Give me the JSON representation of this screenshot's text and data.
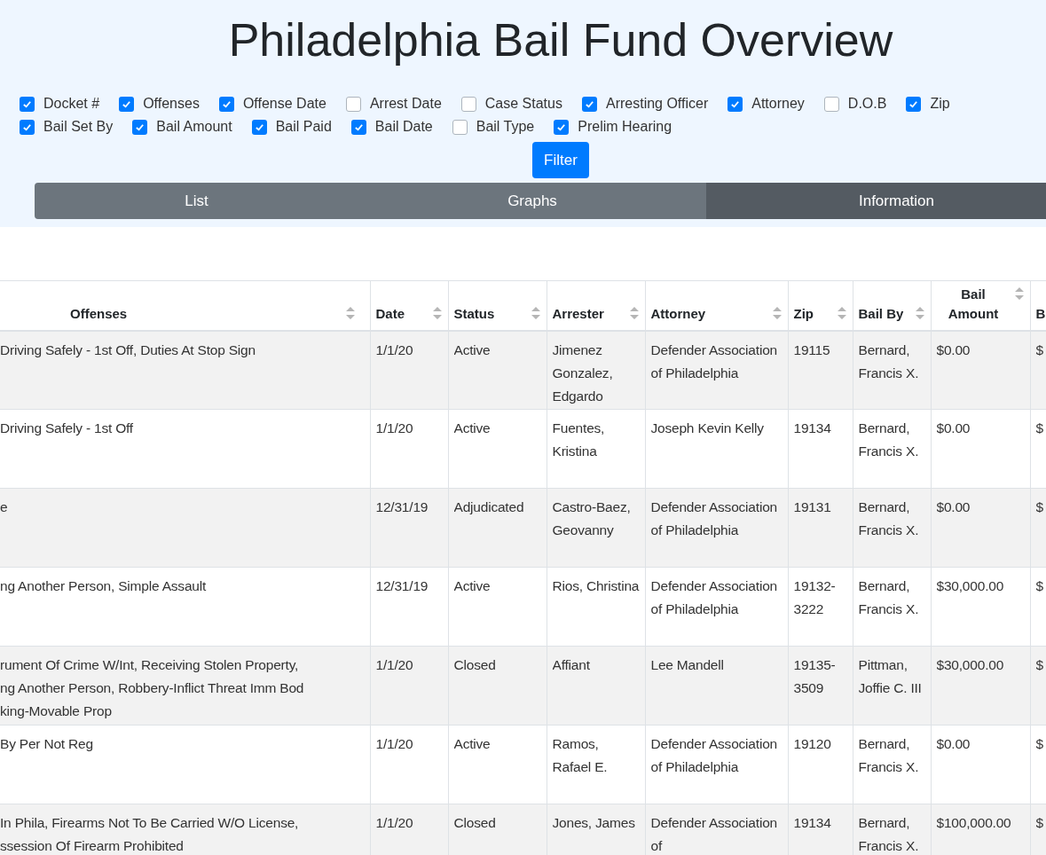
{
  "title": "Philadelphia Bail Fund Overview",
  "filters": [
    {
      "label": "Docket #",
      "checked": true
    },
    {
      "label": "Offenses",
      "checked": true
    },
    {
      "label": "Offense Date",
      "checked": true
    },
    {
      "label": "Arrest Date",
      "checked": false
    },
    {
      "label": "Case Status",
      "checked": false
    },
    {
      "label": "Arresting Officer",
      "checked": true
    },
    {
      "label": "Attorney",
      "checked": true
    },
    {
      "label": "D.O.B",
      "checked": false
    },
    {
      "label": "Zip",
      "checked": true
    },
    {
      "label": "Bail Set By",
      "checked": true
    },
    {
      "label": "Bail Amount",
      "checked": true
    },
    {
      "label": "Bail Paid",
      "checked": true
    },
    {
      "label": "Bail Date",
      "checked": true
    },
    {
      "label": "Bail Type",
      "checked": false
    },
    {
      "label": "Prelim Hearing",
      "checked": true
    }
  ],
  "filter_button": "Filter",
  "tabs": [
    {
      "label": "List",
      "selected": false
    },
    {
      "label": "Graphs",
      "selected": false
    },
    {
      "label": "Information",
      "selected": true
    }
  ],
  "table": {
    "columns": [
      {
        "label": "Offenses"
      },
      {
        "label": "Date"
      },
      {
        "label": "Status"
      },
      {
        "label": "Arrester"
      },
      {
        "label": "Attorney"
      },
      {
        "label": "Zip"
      },
      {
        "label": "Bail By"
      },
      {
        "label": "Bail Amount"
      },
      {
        "label": "B"
      }
    ],
    "rows": [
      {
        "cells": [
          "Driving Safely - 1st Off, Duties At Stop Sign",
          "1/1/20",
          "Active",
          "Jimenez Gonzalez, Edgardo",
          "Defender Association of Philadelphia",
          "19115",
          "Bernard, Francis X.",
          "$0.00",
          "$"
        ]
      },
      {
        "cells": [
          "Driving Safely - 1st Off",
          "1/1/20",
          "Active",
          "Fuentes, Kristina",
          "Joseph Kevin Kelly",
          "19134",
          "Bernard, Francis X.",
          "$0.00",
          "$"
        ]
      },
      {
        "cells": [
          "e",
          "12/31/19",
          "Adjudicated",
          "Castro-Baez, Geovanny",
          "Defender Association of Philadelphia",
          "19131",
          "Bernard, Francis X.",
          "$0.00",
          "$"
        ]
      },
      {
        "cells": [
          "ng Another Person, Simple Assault",
          "12/31/19",
          "Active",
          "Rios, Christina",
          "Defender Association of Philadelphia",
          "19132-3222",
          "Bernard, Francis X.",
          "$30,000.00",
          "$"
        ]
      },
      {
        "cells": [
          "rument Of Crime W/Int, Receiving Stolen Property,\nng Another Person, Robbery-Inflict Threat Imm Bod\nking-Movable Prop",
          "1/1/20",
          "Closed",
          "Affiant",
          "Lee Mandell",
          "19135-3509",
          "Pittman, Joffie C. III",
          "$30,000.00",
          "$"
        ]
      },
      {
        "cells": [
          "By Per Not Reg",
          "1/1/20",
          "Active",
          "Ramos, Rafael E.",
          "Defender Association of Philadelphia",
          "19120",
          "Bernard, Francis X.",
          "$0.00",
          "$"
        ]
      },
      {
        "cells": [
          "In Phila, Firearms Not To Be Carried W/O License,\nssession Of Firearm Prohibited",
          "1/1/20",
          "Closed",
          "Jones, James",
          "Defender Association of",
          "19134",
          "Bernard, Francis X.",
          "$100,000.00",
          "$"
        ]
      }
    ]
  }
}
